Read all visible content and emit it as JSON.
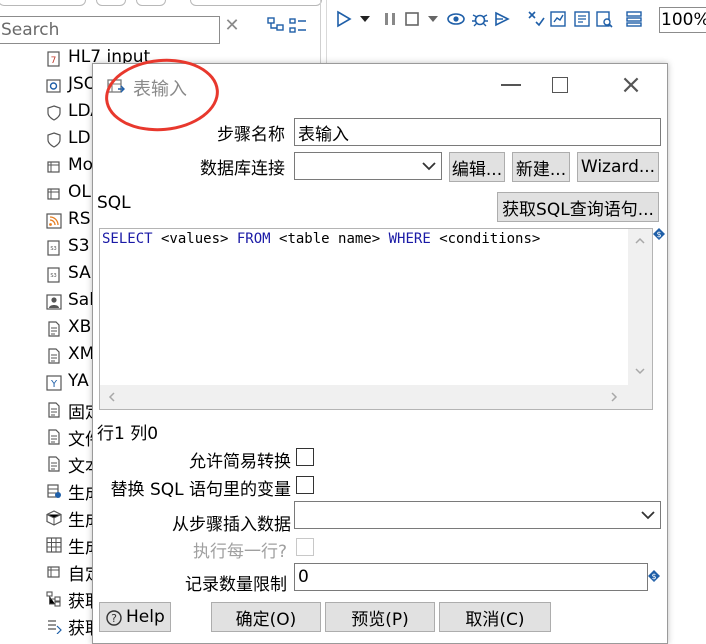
{
  "left_panel": {
    "search": {
      "placeholder": "Search"
    },
    "tree_items": [
      {
        "label": "HL7 input",
        "icon": "hl7-icon"
      },
      {
        "label": "JSON",
        "icon": "json-icon"
      },
      {
        "label": "LDAP",
        "icon": "ldap-icon"
      },
      {
        "label": "LDIF",
        "icon": "ldif-icon"
      },
      {
        "label": "Mo",
        "icon": "table-icon"
      },
      {
        "label": "OL",
        "icon": "table-icon"
      },
      {
        "label": "RS",
        "icon": "rss-icon"
      },
      {
        "label": "S3",
        "icon": "s3-icon"
      },
      {
        "label": "SA",
        "icon": "sas-icon"
      },
      {
        "label": "Sal",
        "icon": "salesforce-icon"
      },
      {
        "label": "XB",
        "icon": "xbase-icon"
      },
      {
        "label": "XM",
        "icon": "xml-icon"
      },
      {
        "label": "YA",
        "icon": "yaml-icon"
      },
      {
        "label": "固定",
        "icon": "file-icon"
      },
      {
        "label": "文件",
        "icon": "file-icon"
      },
      {
        "label": "文本",
        "icon": "file-icon"
      },
      {
        "label": "生成",
        "icon": "generate-rows-icon"
      },
      {
        "label": "生成",
        "icon": "cube-icon"
      },
      {
        "label": "生成",
        "icon": "grid-icon"
      },
      {
        "label": "自定",
        "icon": "table-icon"
      },
      {
        "label": "获取",
        "icon": "tree-icon"
      },
      {
        "label": "获取",
        "icon": "fields-icon"
      }
    ]
  },
  "toolbar": {
    "zoom": "100%"
  },
  "dialog": {
    "title": "表输入",
    "step_name_label": "步骤名称",
    "step_name_value": "表输入",
    "db_conn_label": "数据库连接",
    "db_conn_value": "",
    "edit_button": "编辑...",
    "new_button": "新建...",
    "wizard_button": "Wizard...",
    "sql_label": "SQL",
    "get_sql_button": "获取SQL查询语句...",
    "sql": {
      "k1": "SELECT",
      "t1": " <values> ",
      "k2": "FROM",
      "t2": " <table name> ",
      "k3": "WHERE",
      "t3": " <conditions>"
    },
    "cursor_position": "行1 列0",
    "lazy_conversion_label": "允许简易转换",
    "replace_vars_label": "替换 SQL 语句里的变量",
    "insert_from_step_label": "从步骤插入数据",
    "insert_from_step_value": "",
    "exec_each_row_label": "执行每一行?",
    "limit_label": "记录数量限制",
    "limit_value": "0",
    "help_button": "Help",
    "ok_button": "确定(O)",
    "preview_button": "预览(P)",
    "cancel_button": "取消(C)"
  },
  "colors": {
    "annotation": "#e8382d",
    "sql_keyword": "#1a1aa6",
    "toolbar_icon": "#1f5fa8"
  }
}
